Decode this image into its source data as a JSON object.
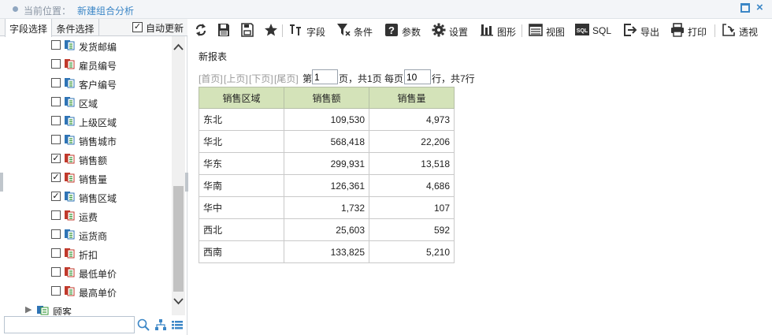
{
  "header": {
    "location_label": "当前位置：",
    "current_page": "新建组合分析"
  },
  "left_panel": {
    "tabs": [
      "字段选择",
      "条件选择"
    ],
    "auto_update_label": "自动更新",
    "auto_update_checked": true,
    "fields": [
      {
        "label": "发货邮编",
        "checked": false,
        "type": "text"
      },
      {
        "label": "雇员编号",
        "checked": false,
        "type": "number"
      },
      {
        "label": "客户编号",
        "checked": false,
        "type": "text"
      },
      {
        "label": "区域",
        "checked": false,
        "type": "text"
      },
      {
        "label": "上级区域",
        "checked": false,
        "type": "text"
      },
      {
        "label": "销售城市",
        "checked": false,
        "type": "text"
      },
      {
        "label": "销售额",
        "checked": true,
        "type": "number"
      },
      {
        "label": "销售量",
        "checked": true,
        "type": "number"
      },
      {
        "label": "销售区域",
        "checked": true,
        "type": "text"
      },
      {
        "label": "运费",
        "checked": false,
        "type": "number"
      },
      {
        "label": "运货商",
        "checked": false,
        "type": "text"
      },
      {
        "label": "折扣",
        "checked": false,
        "type": "number"
      },
      {
        "label": "最低单价",
        "checked": false,
        "type": "number"
      },
      {
        "label": "最高单价",
        "checked": false,
        "type": "number"
      }
    ],
    "group": {
      "label": "顾客"
    },
    "search_placeholder": ""
  },
  "toolbar": {
    "buttons": [
      {
        "id": "refresh",
        "label": ""
      },
      {
        "id": "save",
        "label": ""
      },
      {
        "id": "saveas",
        "label": ""
      },
      {
        "id": "favorite",
        "label": ""
      },
      {
        "id": "fields",
        "label": "字段"
      },
      {
        "id": "conditions",
        "label": "条件"
      },
      {
        "id": "params",
        "label": "参数"
      },
      {
        "id": "settings",
        "label": "设置"
      },
      {
        "id": "graphics",
        "label": "图形"
      },
      {
        "id": "view",
        "label": "视图"
      },
      {
        "id": "sql",
        "label": "SQL"
      },
      {
        "id": "export",
        "label": "导出"
      },
      {
        "id": "print",
        "label": "打印"
      },
      {
        "id": "pivot",
        "label": "透视"
      }
    ]
  },
  "report": {
    "title": "新报表",
    "pager": {
      "first": "[首页]",
      "prev": "[上页]",
      "next": "[下页]",
      "last": "[尾页]",
      "page_prefix": "第",
      "page_value": "1",
      "page_suffix": "页，共1页 每页",
      "rows_value": "10",
      "rows_suffix": "行，共7行"
    },
    "columns": [
      "销售区域",
      "销售额",
      "销售量"
    ],
    "rows": [
      [
        "东北",
        "109,530",
        "4,973"
      ],
      [
        "华北",
        "568,418",
        "22,206"
      ],
      [
        "华东",
        "299,931",
        "13,518"
      ],
      [
        "华南",
        "126,361",
        "4,686"
      ],
      [
        "华中",
        "1,732",
        "107"
      ],
      [
        "西北",
        "25,603",
        "592"
      ],
      [
        "西南",
        "133,825",
        "5,210"
      ]
    ]
  },
  "colors": {
    "accent": "#3b86c6",
    "table_header": "#d4e3b9"
  }
}
